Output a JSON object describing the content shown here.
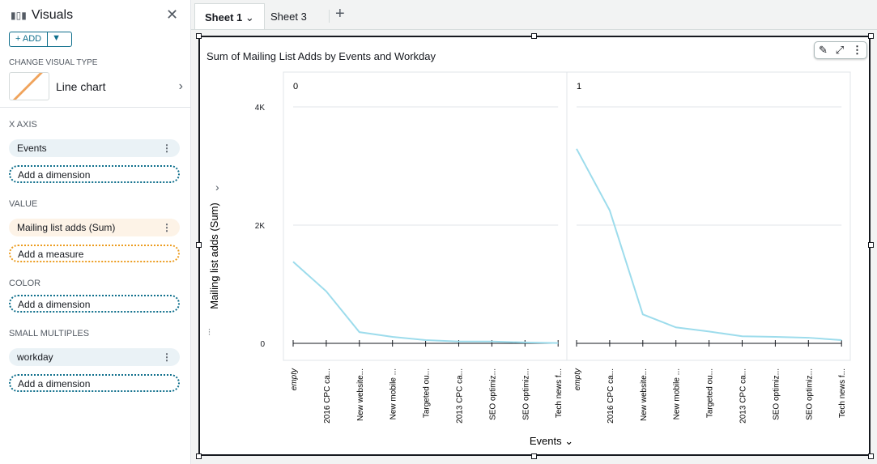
{
  "sidebar": {
    "title": "Visuals",
    "add_label": "+ ADD",
    "change_type_label": "CHANGE VISUAL TYPE",
    "visual_type": "Line chart",
    "sections": [
      {
        "label": "X AXIS",
        "field": "Events",
        "add": "Add a dimension"
      },
      {
        "label": "VALUE",
        "field": "Mailing list adds (Sum)",
        "add": "Add a measure"
      },
      {
        "label": "COLOR",
        "add": "Add a dimension"
      },
      {
        "label": "SMALL MULTIPLES",
        "field": "workday",
        "add": "Add a dimension"
      }
    ]
  },
  "tabs": [
    {
      "label": "Sheet 1",
      "active": true
    },
    {
      "label": "Sheet 3"
    }
  ],
  "visual": {
    "title": "Sum of Mailing List Adds by Events and Workday"
  },
  "chart_data": {
    "type": "line",
    "title": "Sum of Mailing List Adds by Events and Workday",
    "xlabel": "Events",
    "ylabel": "Mailing list adds (Sum)",
    "ylim": [
      0,
      4000
    ],
    "yticks": [
      "0",
      "2K",
      "4K"
    ],
    "grid": true,
    "line_color": "#9ddcec",
    "categories": [
      "empty",
      "2016 CPC ca...",
      "New website...",
      "New mobile ...",
      "Targeted ou...",
      "2013 CPC ca...",
      "SEO optimiz...",
      "SEO optimiz...",
      "Tech news f..."
    ],
    "panels": [
      {
        "label": "0",
        "values": [
          1380,
          880,
          190,
          110,
          55,
          30,
          30,
          15,
          5
        ]
      },
      {
        "label": "1",
        "values": [
          3290,
          2250,
          490,
          270,
          200,
          120,
          110,
          95,
          55
        ]
      }
    ]
  }
}
